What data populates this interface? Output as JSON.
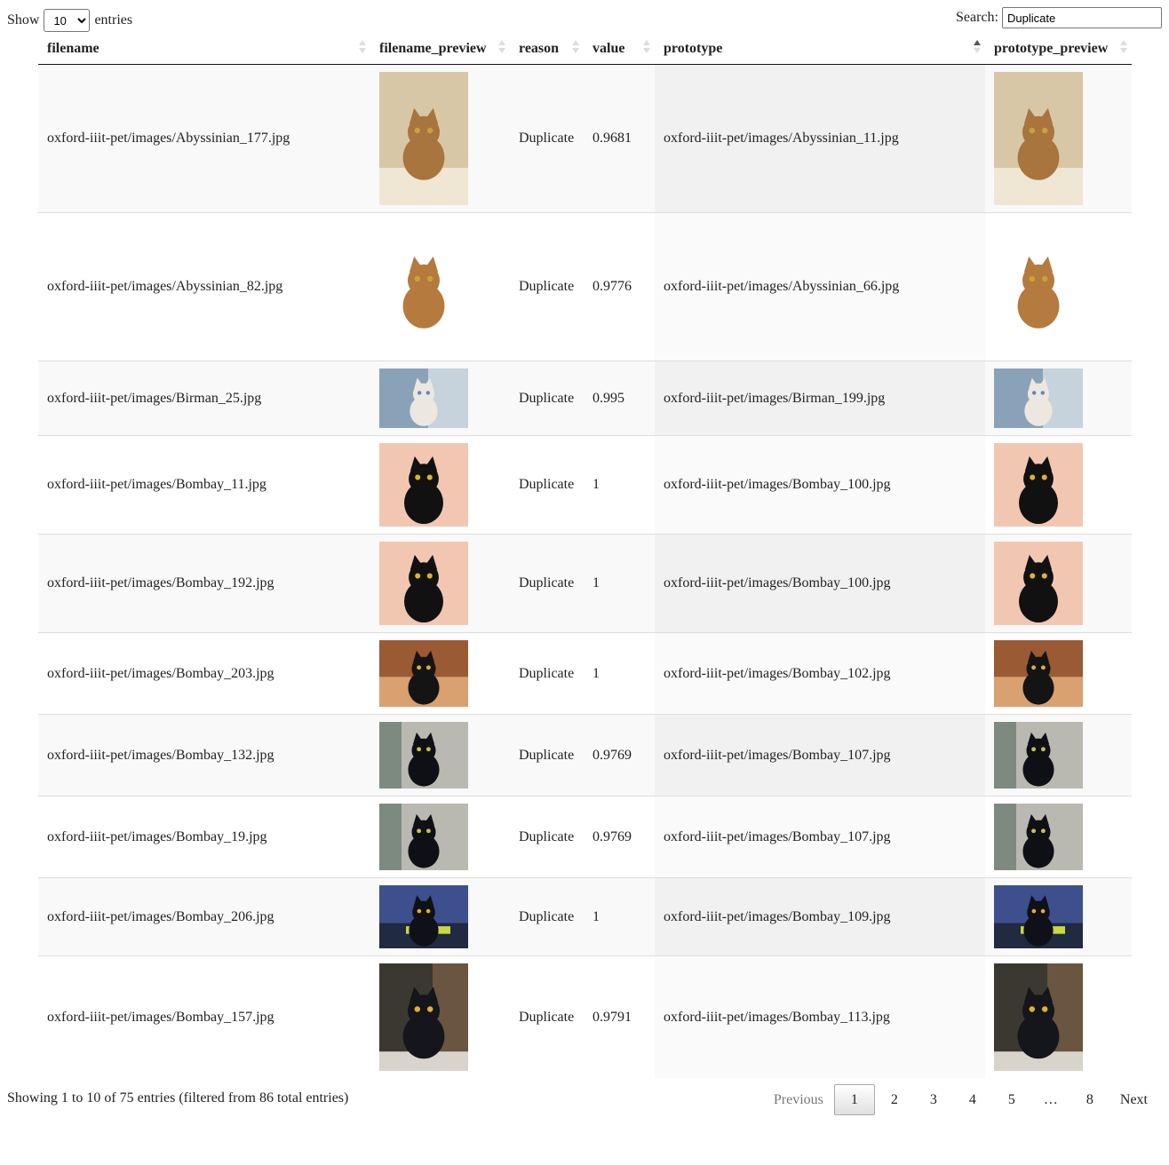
{
  "length_menu": {
    "show_label": "Show",
    "entries_label": "entries",
    "selected": "10"
  },
  "search": {
    "label": "Search:",
    "value": "Duplicate"
  },
  "columns": [
    "filename",
    "filename_preview",
    "reason",
    "value",
    "prototype",
    "prototype_preview"
  ],
  "rows": [
    {
      "filename": "oxford-iiit-pet/images/Abyssinian_177.jpg",
      "reason": "Duplicate",
      "value": "0.9681",
      "prototype": "oxford-iiit-pet/images/Abyssinian_11.jpg"
    },
    {
      "filename": "oxford-iiit-pet/images/Abyssinian_82.jpg",
      "reason": "Duplicate",
      "value": "0.9776",
      "prototype": "oxford-iiit-pet/images/Abyssinian_66.jpg"
    },
    {
      "filename": "oxford-iiit-pet/images/Birman_25.jpg",
      "reason": "Duplicate",
      "value": "0.995",
      "prototype": "oxford-iiit-pet/images/Birman_199.jpg"
    },
    {
      "filename": "oxford-iiit-pet/images/Bombay_11.jpg",
      "reason": "Duplicate",
      "value": "1",
      "prototype": "oxford-iiit-pet/images/Bombay_100.jpg"
    },
    {
      "filename": "oxford-iiit-pet/images/Bombay_192.jpg",
      "reason": "Duplicate",
      "value": "1",
      "prototype": "oxford-iiit-pet/images/Bombay_100.jpg"
    },
    {
      "filename": "oxford-iiit-pet/images/Bombay_203.jpg",
      "reason": "Duplicate",
      "value": "1",
      "prototype": "oxford-iiit-pet/images/Bombay_102.jpg"
    },
    {
      "filename": "oxford-iiit-pet/images/Bombay_132.jpg",
      "reason": "Duplicate",
      "value": "0.9769",
      "prototype": "oxford-iiit-pet/images/Bombay_107.jpg"
    },
    {
      "filename": "oxford-iiit-pet/images/Bombay_19.jpg",
      "reason": "Duplicate",
      "value": "0.9769",
      "prototype": "oxford-iiit-pet/images/Bombay_107.jpg"
    },
    {
      "filename": "oxford-iiit-pet/images/Bombay_206.jpg",
      "reason": "Duplicate",
      "value": "1",
      "prototype": "oxford-iiit-pet/images/Bombay_109.jpg"
    },
    {
      "filename": "oxford-iiit-pet/images/Bombay_157.jpg",
      "reason": "Duplicate",
      "value": "0.9791",
      "prototype": "oxford-iiit-pet/images/Bombay_113.jpg"
    }
  ],
  "info": "Showing 1 to 10 of 75 entries (filtered from 86 total entries)",
  "pagination": {
    "previous": "Previous",
    "pages": [
      "1",
      "2",
      "3",
      "4",
      "5",
      "…",
      "8"
    ],
    "current": "1",
    "next": "Next"
  }
}
